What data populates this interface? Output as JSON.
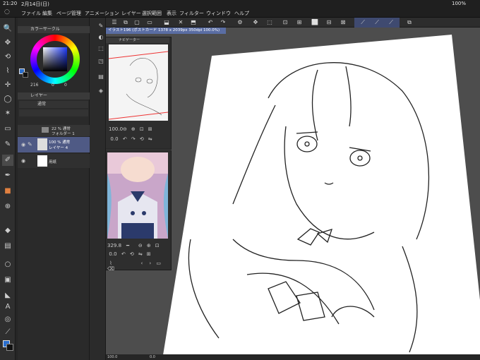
{
  "status": {
    "time": "21:20",
    "date": "2月14日(日)",
    "battery": "100%"
  },
  "menu": [
    "ファイル",
    "編集",
    "ページ管理",
    "アニメーション",
    "レイヤー",
    "選択範囲",
    "表示",
    "フィルター",
    "ウィンドウ",
    "ヘルプ"
  ],
  "color_panel": {
    "title": "カラーサークル",
    "values": [
      "216",
      "0",
      "0"
    ]
  },
  "layer_panel": {
    "title": "レイヤー",
    "blend": "通常",
    "layers": [
      {
        "opacity": "22 % 通常",
        "name": "フォルダー 1"
      },
      {
        "opacity": "100 % 通常",
        "name": "レイヤー 4"
      },
      {
        "opacity": "",
        "name": "用紙"
      }
    ]
  },
  "navigator": {
    "title": "ナビゲーター",
    "zoom": "100.0",
    "angle": "0.0"
  },
  "subview": {
    "zoom": "329.8",
    "angle": "0.0"
  },
  "document_tab": "イラスト196 (ポストカード 1378 x 2039px 350dpi 100.0%)",
  "bottom": {
    "zoom": "100.0",
    "angle": "0.0"
  },
  "accent": "#5a6da3",
  "icons": [
    "pen-icon",
    "eraser-icon",
    "fill-icon",
    "text-icon",
    "move-icon",
    "lasso-icon",
    "zoom-icon"
  ]
}
